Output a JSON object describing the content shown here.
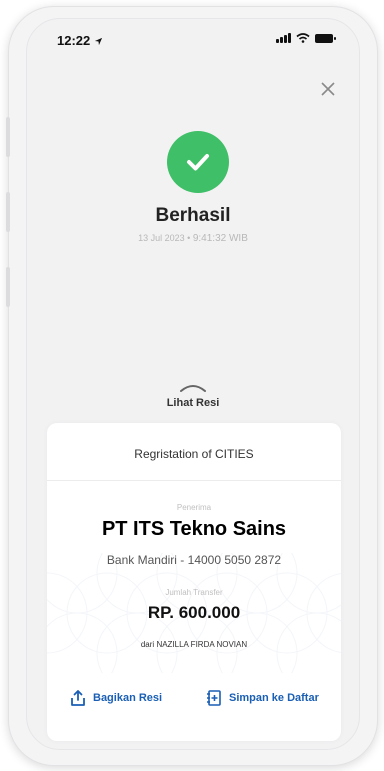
{
  "status_bar": {
    "time": "12:22"
  },
  "success": {
    "title": "Berhasil",
    "date": "13 Jul 2023",
    "separator": "•",
    "time": "9:41:32 WIB"
  },
  "receipt_toggle": {
    "label": "Lihat Resi"
  },
  "receipt": {
    "title": "Regristation of CITIES",
    "recipient_label": "Penerima",
    "recipient_name": "PT ITS Tekno Sains",
    "bank_name": "Bank Mandiri -",
    "account_number": "14000 5050 2872",
    "amount_label": "Jumlah Transfer",
    "amount": "RP. 600.000",
    "sender_prefix": "dari",
    "sender_name": "NAZILLA FIRDA NOVIAN"
  },
  "actions": {
    "share_label": "Bagikan Resi",
    "save_label": "Simpan ke Daftar"
  },
  "colors": {
    "success_green": "#3fbf67",
    "action_blue": "#1a5fb4"
  }
}
